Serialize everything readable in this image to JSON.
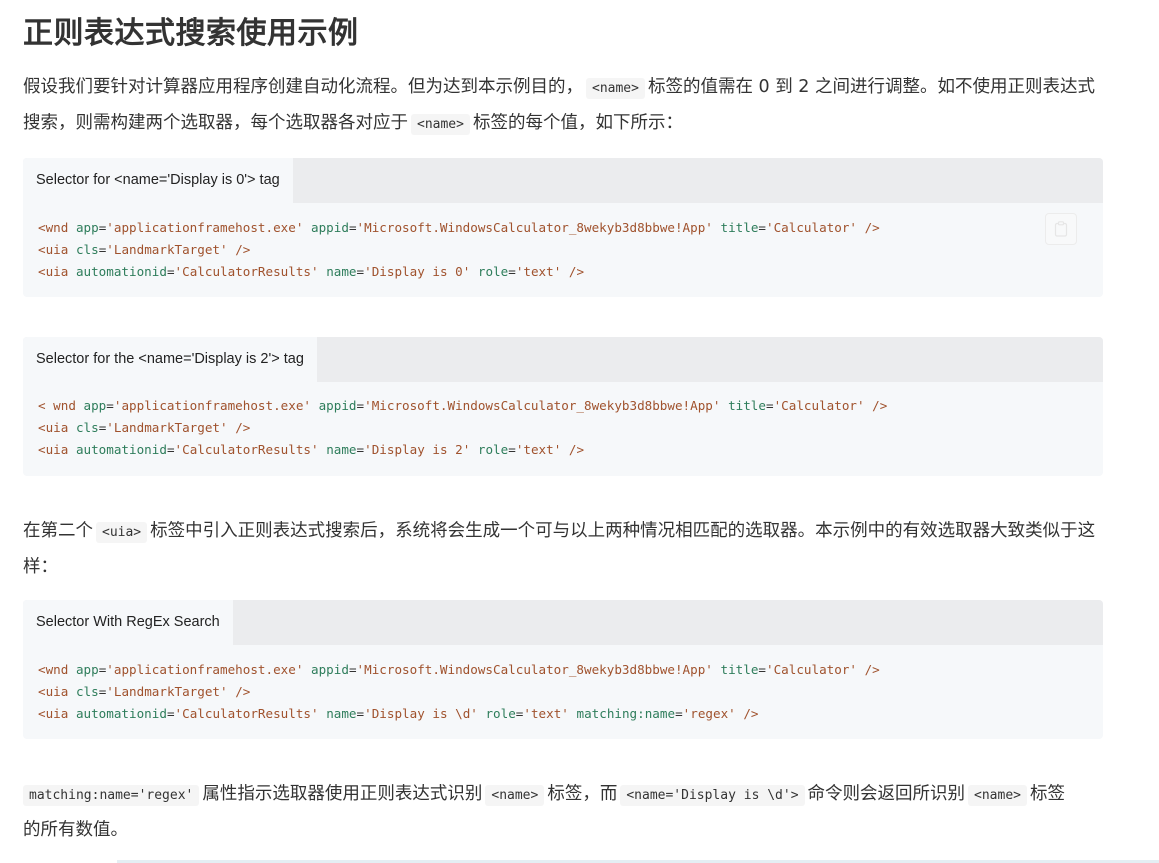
{
  "title": "正则表达式搜索使用示例",
  "intro": {
    "part1": "假设我们要针对计算器应用程序创建自动化流程。但为达到本示例目的，",
    "code1": "<name>",
    "part2": "标签的值需在 0 到 2 之间进行调整。如不使用正则表达式",
    "part3": "搜索，则需构建两个选取器，每个选取器各对应于",
    "code2": "<name>",
    "part4": "标签的每个值，如下所示："
  },
  "blocks": [
    {
      "label": "Selector for <name='Display is 0'> tag",
      "lines": [
        [
          {
            "t": "tag",
            "v": "<wnd"
          },
          {
            "t": "plain",
            "v": " "
          },
          {
            "t": "attr",
            "v": "app"
          },
          {
            "t": "plain",
            "v": "="
          },
          {
            "t": "val",
            "v": "'applicationframehost.exe'"
          },
          {
            "t": "plain",
            "v": " "
          },
          {
            "t": "attr",
            "v": "appid"
          },
          {
            "t": "plain",
            "v": "="
          },
          {
            "t": "val",
            "v": "'Microsoft.WindowsCalculator_8wekyb3d8bbwe!App'"
          },
          {
            "t": "plain",
            "v": " "
          },
          {
            "t": "attr",
            "v": "title"
          },
          {
            "t": "plain",
            "v": "="
          },
          {
            "t": "val",
            "v": "'Calculator'"
          },
          {
            "t": "plain",
            "v": " "
          },
          {
            "t": "tag",
            "v": "/>"
          }
        ],
        [
          {
            "t": "tag",
            "v": "<uia"
          },
          {
            "t": "plain",
            "v": " "
          },
          {
            "t": "attr",
            "v": "cls"
          },
          {
            "t": "plain",
            "v": "="
          },
          {
            "t": "val",
            "v": "'LandmarkTarget'"
          },
          {
            "t": "plain",
            "v": " "
          },
          {
            "t": "tag",
            "v": "/>"
          }
        ],
        [
          {
            "t": "tag",
            "v": "<uia"
          },
          {
            "t": "plain",
            "v": " "
          },
          {
            "t": "attr",
            "v": "automationid"
          },
          {
            "t": "plain",
            "v": "="
          },
          {
            "t": "val",
            "v": "'CalculatorResults'"
          },
          {
            "t": "plain",
            "v": " "
          },
          {
            "t": "attr",
            "v": "name"
          },
          {
            "t": "plain",
            "v": "="
          },
          {
            "t": "val",
            "v": "'Display is 0'"
          },
          {
            "t": "plain",
            "v": " "
          },
          {
            "t": "attr",
            "v": "role"
          },
          {
            "t": "plain",
            "v": "="
          },
          {
            "t": "val",
            "v": "'text'"
          },
          {
            "t": "plain",
            "v": " "
          },
          {
            "t": "tag",
            "v": "/>"
          }
        ]
      ]
    },
    {
      "label": "Selector for the <name='Display is 2'> tag",
      "lines": [
        [
          {
            "t": "tag",
            "v": "< wnd"
          },
          {
            "t": "plain",
            "v": " "
          },
          {
            "t": "attr",
            "v": "app"
          },
          {
            "t": "plain",
            "v": "="
          },
          {
            "t": "val",
            "v": "'applicationframehost.exe'"
          },
          {
            "t": "plain",
            "v": " "
          },
          {
            "t": "attr",
            "v": "appid"
          },
          {
            "t": "plain",
            "v": "="
          },
          {
            "t": "val",
            "v": "'Microsoft.WindowsCalculator_8wekyb3d8bbwe!App'"
          },
          {
            "t": "plain",
            "v": " "
          },
          {
            "t": "attr",
            "v": "title"
          },
          {
            "t": "plain",
            "v": "="
          },
          {
            "t": "val",
            "v": "'Calculator'"
          },
          {
            "t": "plain",
            "v": " "
          },
          {
            "t": "tag",
            "v": "/>"
          }
        ],
        [
          {
            "t": "tag",
            "v": "<uia"
          },
          {
            "t": "plain",
            "v": " "
          },
          {
            "t": "attr",
            "v": "cls"
          },
          {
            "t": "plain",
            "v": "="
          },
          {
            "t": "val",
            "v": "'LandmarkTarget'"
          },
          {
            "t": "plain",
            "v": " "
          },
          {
            "t": "tag",
            "v": "/>"
          }
        ],
        [
          {
            "t": "tag",
            "v": "<uia"
          },
          {
            "t": "plain",
            "v": " "
          },
          {
            "t": "attr",
            "v": "automationid"
          },
          {
            "t": "plain",
            "v": "="
          },
          {
            "t": "val",
            "v": "'CalculatorResults'"
          },
          {
            "t": "plain",
            "v": " "
          },
          {
            "t": "attr",
            "v": "name"
          },
          {
            "t": "plain",
            "v": "="
          },
          {
            "t": "val",
            "v": "'Display is 2'"
          },
          {
            "t": "plain",
            "v": " "
          },
          {
            "t": "attr",
            "v": "role"
          },
          {
            "t": "plain",
            "v": "="
          },
          {
            "t": "val",
            "v": "'text'"
          },
          {
            "t": "plain",
            "v": " "
          },
          {
            "t": "tag",
            "v": "/>"
          }
        ]
      ]
    },
    {
      "label": "Selector With RegEx Search",
      "lines": [
        [
          {
            "t": "tag",
            "v": "<wnd"
          },
          {
            "t": "plain",
            "v": " "
          },
          {
            "t": "attr",
            "v": "app"
          },
          {
            "t": "plain",
            "v": "="
          },
          {
            "t": "val",
            "v": "'applicationframehost.exe'"
          },
          {
            "t": "plain",
            "v": " "
          },
          {
            "t": "attr",
            "v": "appid"
          },
          {
            "t": "plain",
            "v": "="
          },
          {
            "t": "val",
            "v": "'Microsoft.WindowsCalculator_8wekyb3d8bbwe!App'"
          },
          {
            "t": "plain",
            "v": " "
          },
          {
            "t": "attr",
            "v": "title"
          },
          {
            "t": "plain",
            "v": "="
          },
          {
            "t": "val",
            "v": "'Calculator'"
          },
          {
            "t": "plain",
            "v": " "
          },
          {
            "t": "tag",
            "v": "/>"
          }
        ],
        [
          {
            "t": "tag",
            "v": "<uia"
          },
          {
            "t": "plain",
            "v": " "
          },
          {
            "t": "attr",
            "v": "cls"
          },
          {
            "t": "plain",
            "v": "="
          },
          {
            "t": "val",
            "v": "'LandmarkTarget'"
          },
          {
            "t": "plain",
            "v": " "
          },
          {
            "t": "tag",
            "v": "/>"
          }
        ],
        [
          {
            "t": "tag",
            "v": "<uia"
          },
          {
            "t": "plain",
            "v": " "
          },
          {
            "t": "attr",
            "v": "automationid"
          },
          {
            "t": "plain",
            "v": "="
          },
          {
            "t": "val",
            "v": "'CalculatorResults'"
          },
          {
            "t": "plain",
            "v": " "
          },
          {
            "t": "attr",
            "v": "name"
          },
          {
            "t": "plain",
            "v": "="
          },
          {
            "t": "val",
            "v": "'Display is \\d'"
          },
          {
            "t": "plain",
            "v": " "
          },
          {
            "t": "attr",
            "v": "role"
          },
          {
            "t": "plain",
            "v": "="
          },
          {
            "t": "val",
            "v": "'text'"
          },
          {
            "t": "plain",
            "v": " "
          },
          {
            "t": "attr",
            "v": "matching:name"
          },
          {
            "t": "plain",
            "v": "="
          },
          {
            "t": "val",
            "v": "'regex'"
          },
          {
            "t": "plain",
            "v": " "
          },
          {
            "t": "tag",
            "v": "/>"
          }
        ]
      ]
    }
  ],
  "middle": {
    "part1": "在第二个",
    "code1": "<uia>",
    "part2": "标签中引入正则表达式搜索后，系统将会生成一个可与以上两种情况相匹配的选取器。本示例中的有效选取器大致类似于这",
    "part3": "样："
  },
  "closing": {
    "code1": "matching:name='regex'",
    "part1": "属性指示选取器使用正则表达式识别",
    "code2": "<name>",
    "part2": "标签，而",
    "code3": "<name='Display is \\d'>",
    "part3": "命令则会返回所识别",
    "code4": "<name>",
    "part4": "标签",
    "part5": "的所有数值。"
  },
  "icons": {
    "copy": "copy-icon"
  }
}
